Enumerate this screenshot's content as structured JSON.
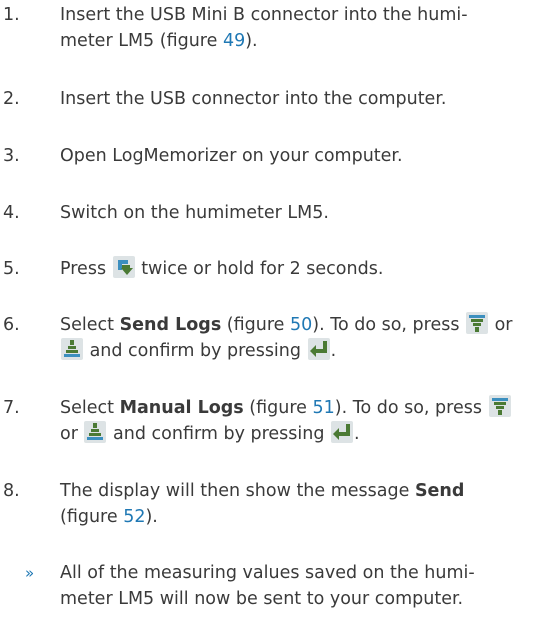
{
  "steps": [
    {
      "num": "1.",
      "line1": "Insert the USB Mini B connector into the humi-",
      "line2_pre": "meter LM5 (figure ",
      "line2_link": "49",
      "line2_post": ")."
    },
    {
      "num": "2.",
      "text": "Insert the USB connector into the computer."
    },
    {
      "num": "3.",
      "text": "Open LogMemorizer on your computer."
    },
    {
      "num": "4.",
      "text": "Switch on the humimeter LM5."
    },
    {
      "num": "5.",
      "pre": "Press ",
      "icon": "menu-arrow-icon",
      "post": " twice or hold for 2 seconds."
    },
    {
      "num": "6.",
      "a": "Select ",
      "bold": "Send Logs",
      "b": " (figure ",
      "link": "50",
      "c": "). To do so, press ",
      "icon1": "scroll-down-icon",
      "d": " or",
      "icon2": "scroll-up-icon",
      "e": " and confirm by pressing ",
      "icon3": "enter-icon",
      "f": "."
    },
    {
      "num": "7.",
      "a": "Select ",
      "bold": "Manual Logs",
      "b": " (figure ",
      "link": "51",
      "c": "). To do so, press ",
      "icon1": "scroll-down-icon",
      "d": "or ",
      "icon2": "scroll-up-icon",
      "e": " and confirm by pressing ",
      "icon3": "enter-icon",
      "f": "."
    },
    {
      "num": "8.",
      "a": "The display will then show the message ",
      "bold": "Send",
      "b": "(figure ",
      "link": "52",
      "c": ")."
    }
  ],
  "result": {
    "bullet": "»",
    "line1": "All of the measuring values saved on the humi-",
    "line2": "meter LM5 will now be sent to your computer."
  },
  "colors": {
    "text": "#3a3a3a",
    "link": "#1f78b4",
    "icon_tile": "#dde3e5",
    "icon_glyph": "#4b7a34",
    "icon_accent": "#3c8fbf"
  }
}
